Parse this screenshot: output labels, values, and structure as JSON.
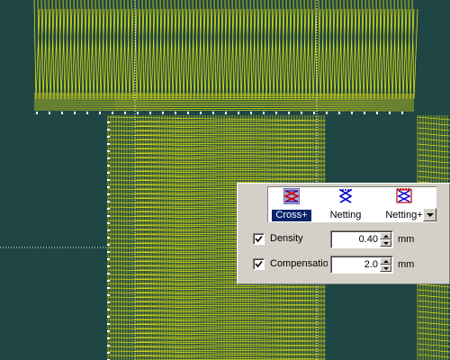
{
  "stitch_types": [
    {
      "label": "Cross+",
      "icon": "cross-plus-stitch-icon",
      "selected": true
    },
    {
      "label": "Netting",
      "icon": "netting-stitch-icon",
      "selected": false
    },
    {
      "label": "Netting+",
      "icon": "netting-plus-stitch-icon",
      "selected": false
    }
  ],
  "density": {
    "label": "Density",
    "value": "0.40",
    "unit": "mm",
    "checked": true
  },
  "compensation": {
    "label": "Compensation",
    "value": "2.0",
    "unit": "mm",
    "checked": true
  },
  "colors": {
    "background": "#1f4545",
    "stitch": "#f2f20a",
    "panel": "#d4d0c8",
    "selection": "#0a246a"
  }
}
